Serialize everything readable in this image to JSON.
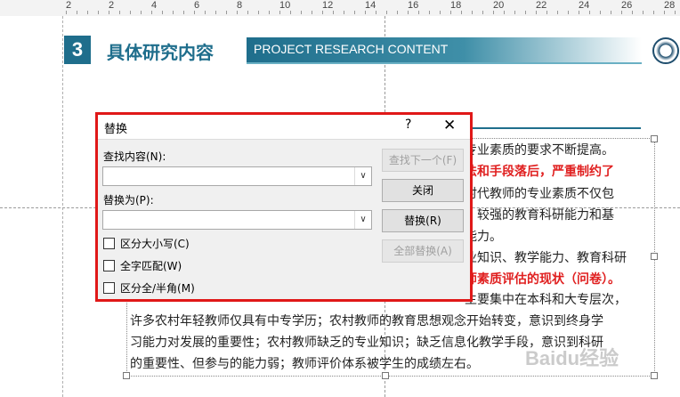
{
  "ruler": {
    "labels": [
      "2",
      "2",
      "4",
      "6",
      "8",
      "10",
      "12",
      "14",
      "16",
      "18",
      "20",
      "22",
      "24",
      "26",
      "28"
    ]
  },
  "slide": {
    "section_number": "3",
    "section_title": "具体研究内容",
    "banner_text": "PROJECT RESEARCH CONTENT",
    "body_lines": [
      {
        "pre": "",
        "text": "专业素质的要求不断提高。",
        "red": false
      },
      {
        "pre": "",
        "text": "法和手段落后，严重制约了",
        "red": true
      },
      {
        "pre": "",
        "text": "时代教师的专业素质不仅包",
        "red": false
      },
      {
        "pre": "",
        "text": "、较强的教育科研能力和基",
        "red": false
      },
      {
        "pre": "",
        "text": "能力。",
        "red": false
      },
      {
        "pre": "",
        "text": "业知识、教学能力、教育科研",
        "red": false
      },
      {
        "pre": "",
        "text": "师素质评估的现状（问卷）。",
        "red": true
      },
      {
        "pre": "",
        "text": "主要集中在本科和大专层次，",
        "red": false
      },
      {
        "pre": "",
        "text": "许多农村年轻教师仅具有中专学历；农村教师的教育思想观念开始转变，意识到终身学",
        "red": false
      },
      {
        "pre": "",
        "text": "习能力对发展的重要性；农村教师缺乏的专业知识；缺乏信息化教学手段，意识到科研",
        "red": false
      },
      {
        "pre": "",
        "text": "的重要性、但参与的能力弱；教师评价体系被学生的成绩左右。",
        "red": false
      }
    ],
    "watermark": "Baidu经验"
  },
  "dialog": {
    "title": "替换",
    "help": "?",
    "close": "✕",
    "find_label": "查找内容(N):",
    "find_value": "",
    "replace_label": "替换为(P):",
    "replace_value": "",
    "buttons": {
      "find_next": "查找下一个(F)",
      "close": "关闭",
      "replace": "替换(R)",
      "replace_all": "全部替换(A)"
    },
    "options": [
      {
        "label": "区分大小写(C)",
        "checked": false
      },
      {
        "label": "全字匹配(W)",
        "checked": false
      },
      {
        "label": "区分全/半角(M)",
        "checked": false
      }
    ]
  }
}
